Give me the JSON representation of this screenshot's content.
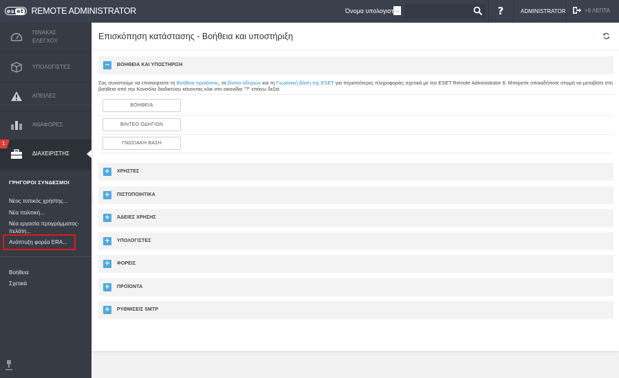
{
  "topbar": {
    "logo_text": "eset",
    "app_title": "REMOTE ADMINISTRATOR",
    "search_scope_label": "Όνομα υπολογιστή",
    "search_placeholder": "",
    "search_value": "",
    "help_label": "?",
    "user_label": "ADMINISTRATOR",
    "logout_label": ">9 ΛΕΠΤΑ"
  },
  "sidebar": {
    "nav": [
      {
        "label": "ΠΙΝΑΚΑΣ ΕΛΕΓΧΟΥ",
        "icon": "dashboard-icon",
        "active": false
      },
      {
        "label": "ΥΠΟΛΟΓΙΣΤΕΣ",
        "icon": "computers-cube-icon",
        "active": false
      },
      {
        "label": "ΑΠΕΙΛΕΣ",
        "icon": "threats-warning-icon",
        "active": false
      },
      {
        "label": "ΑΝΑΦΟΡΕΣ",
        "icon": "reports-bar-icon",
        "active": false
      },
      {
        "label": "ΔΙΑΧΕΙΡΙΣΤΗΣ",
        "icon": "admin-briefcase-icon",
        "active": true,
        "badge": "1"
      }
    ],
    "quick_links_title": "ΓΡΗΓΟΡΟΙ ΣΥΝΔΕΣΜΟΙ",
    "quick_links": [
      "Νέος τοπικός χρήστης...",
      "Νέα πολιτική...",
      "Νέα εργασία προγράμματος-πελάτη...",
      "Ανάπτυξη φορέα ERA..."
    ],
    "bottom_links": [
      "Βοήθεια",
      "Σχετικά"
    ]
  },
  "main": {
    "title": "Επισκόπηση κατάστασης - Βοήθεια και υποστήριξη",
    "expanded_section": {
      "label": "ΒΟΗΘΕΙΑ ΚΑΙ ΥΠΟΣΤΗΡΙΞΗ",
      "intro_part1": "Σας συνιστούμε να επισκεφτείτε τη ",
      "link1": "Βοήθεια προϊόντος",
      "intro_part2": ", τα ",
      "link2": "βίντεο οδηγιών",
      "intro_part3": " και τη ",
      "link3": "Γνωσιακή βάση της ESET",
      "intro_part4": " για περισσότερες πληροφορίες σχετικά με την ESET Remote Administrator 6. Μπορείτε οποιαδήποτε στιγμή να μεταβείτε στη βοήθεια από την Κονσόλα διαδικτύου κάνοντας κλικ στο εικονίδιο \"?\" επάνω δεξιά.",
      "buttons": [
        "ΒΟΗΘΕΙΑ",
        "ΒΙΝΤΕΟ ΟΔΗΓΙΩΝ",
        "ΓΝΩΣΙΑΚΗ ΒΑΣΗ"
      ]
    },
    "collapsed_sections": [
      "ΧΡΗΣΤΕΣ",
      "ΠΙΣΤΟΠΟΙΗΤΙΚΑ",
      "ΆΔΕΙΕΣ ΧΡΗΣΗΣ",
      "ΥΠΟΛΟΓΙΣΤΕΣ",
      "ΦΟΡΕΙΣ",
      "ΠΡΟΪΟΝΤΑ",
      "ΡΥΘΜΙΣΕΙΣ SMTP"
    ],
    "accent_color": "#50a8dd",
    "link_color": "#2e8fc7"
  }
}
